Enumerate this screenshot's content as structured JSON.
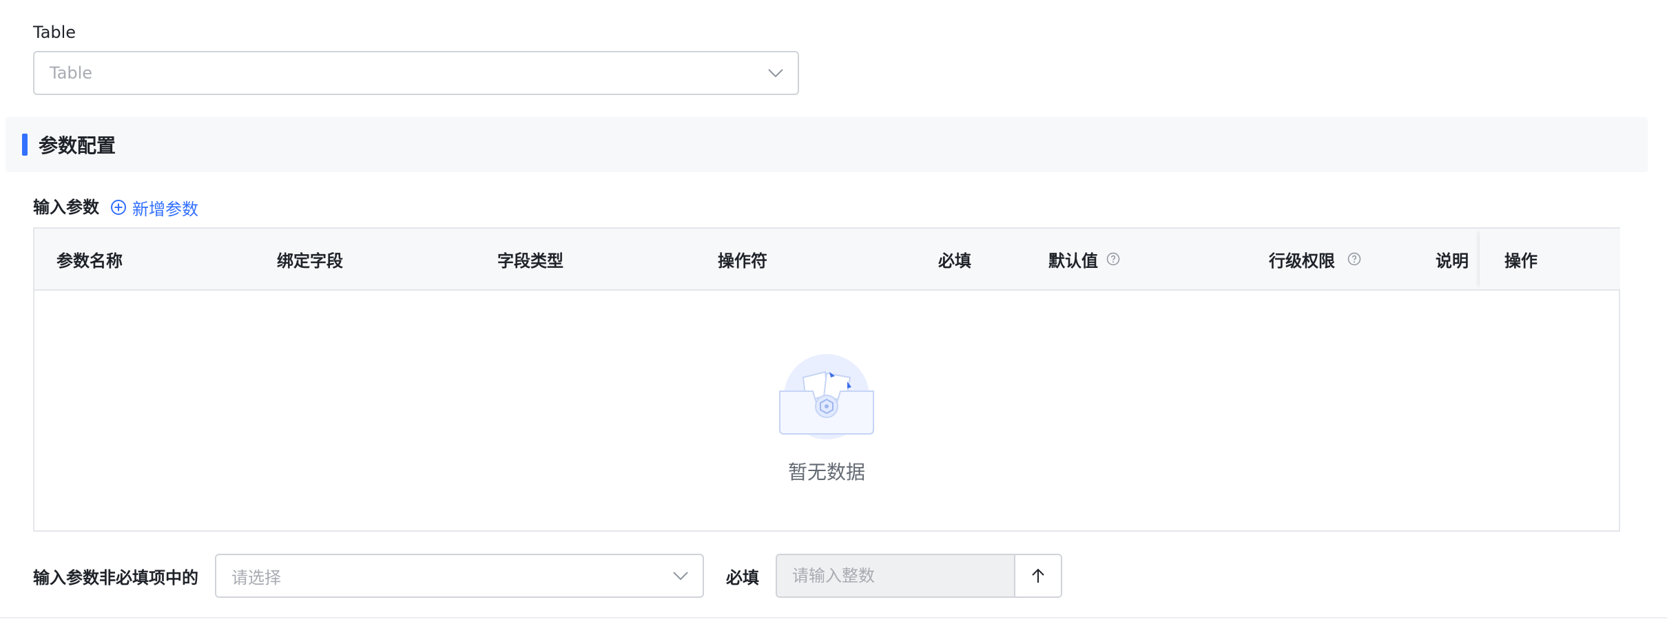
{
  "table_field": {
    "label": "Table",
    "placeholder": "Table",
    "icon": "chevron-down-icon"
  },
  "section": {
    "title": "参数配置",
    "accent": "#3370ff"
  },
  "input_params": {
    "label": "输入参数",
    "add_label": "新增参数",
    "add_icon": "plus-circle-icon",
    "columns": [
      {
        "label": "参数名称",
        "help": false
      },
      {
        "label": "绑定字段",
        "help": false
      },
      {
        "label": "字段类型",
        "help": false
      },
      {
        "label": "操作符",
        "help": false
      },
      {
        "label": "必填",
        "help": false
      },
      {
        "label": "默认值",
        "help": true
      },
      {
        "label": "行级权限",
        "help": true
      },
      {
        "label": "说明",
        "help": false
      },
      {
        "label": "操作",
        "help": false
      }
    ],
    "empty_text": "暂无数据"
  },
  "bottom": {
    "optional_label": "输入参数非必填项中的",
    "optional_placeholder": "请选择",
    "required_label": "必填",
    "integer_placeholder": "请输入整数",
    "step_icon": "arrow-up-icon"
  }
}
